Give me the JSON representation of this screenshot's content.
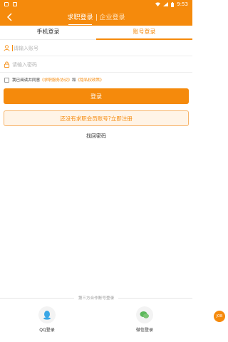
{
  "status": {
    "time": "9:53"
  },
  "header": {
    "tabs": [
      "求职登录",
      "企业登录"
    ]
  },
  "login_tabs": [
    "手机登录",
    "账号登录"
  ],
  "form": {
    "account_placeholder": "请输入账号",
    "password_placeholder": "请输入密码"
  },
  "agreement": {
    "prefix": "我已阅读并同意",
    "service": "《求职服务协议》",
    "and": "和",
    "privacy": "《隐私权政策》"
  },
  "buttons": {
    "login": "登录",
    "register": "还没有求职会员账号?立即注册",
    "forgot": "找回密码"
  },
  "third_party": {
    "title": "第三方合作账号登录",
    "qq": "QQ登录",
    "wechat": "微信登录"
  },
  "badge": "JOB",
  "colors": {
    "accent": "#f58a0c"
  }
}
